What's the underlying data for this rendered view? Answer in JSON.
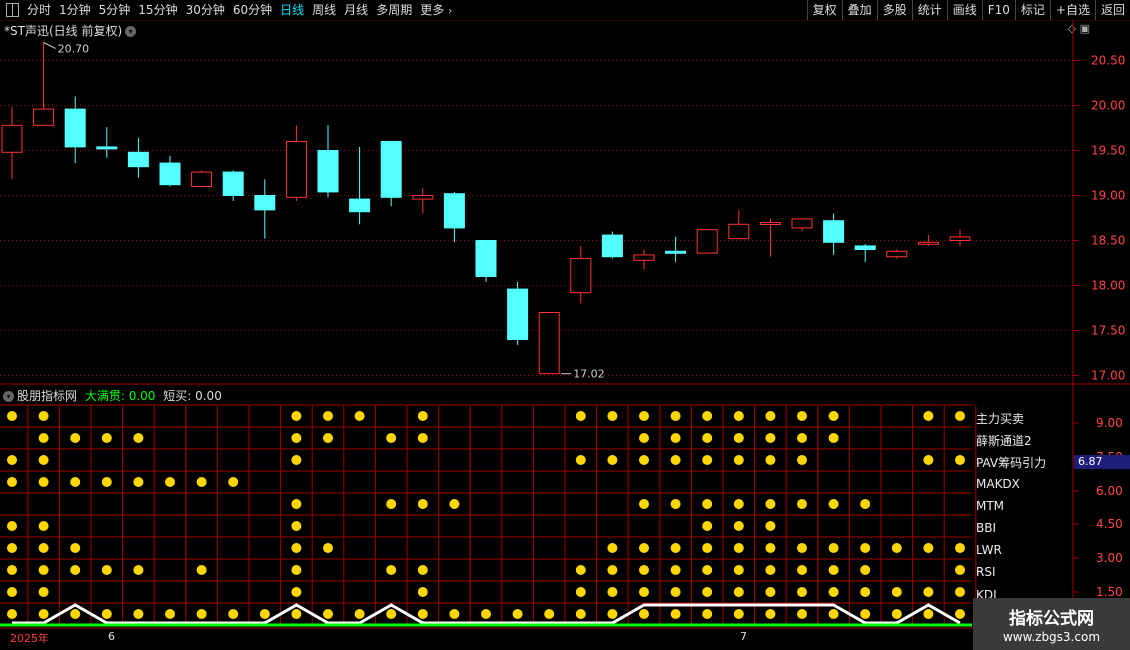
{
  "toolbar": {
    "periods": [
      "分时",
      "1分钟",
      "5分钟",
      "15分钟",
      "30分钟",
      "60分钟",
      "日线",
      "周线",
      "月线",
      "多周期"
    ],
    "active_period": "日线",
    "more_label": "更多",
    "right_buttons": [
      "复权",
      "叠加",
      "多股",
      "统计",
      "画线",
      "F10",
      "标记",
      "+自选",
      "返回"
    ]
  },
  "main_chart": {
    "title": "*ST声迅(日线 前复权)",
    "price_ticks": [
      "20.50",
      "20.00",
      "19.50",
      "19.00",
      "18.50",
      "18.00",
      "17.50",
      "17.00"
    ],
    "high_label": "20.70",
    "low_label": "17.02"
  },
  "indicator": {
    "title": "股朋指标网",
    "series1_label": "大满贯: 0.00",
    "series2_label": "短买: 0.00",
    "value_ticks": [
      "9.00",
      "7.50",
      "6.00",
      "4.50",
      "3.00",
      "1.50"
    ],
    "current_value": "6.87",
    "rows": [
      "主力买卖",
      "薛斯通道2",
      "PAV筹码引力",
      "MAKDX",
      "MTM",
      "BBI",
      "LWR",
      "RSI",
      "KDJ"
    ]
  },
  "date_axis": {
    "labels": [
      "2025年",
      "6",
      "7"
    ]
  },
  "watermark": {
    "line1": "指标公式网",
    "line2": "www.zbgs3.com"
  },
  "colors": {
    "up": "#ff3333",
    "down": "#54ffff",
    "grid": "#a00000",
    "dot": "#ffd700",
    "active": "#00e5ff",
    "green_line": "#00ff00"
  },
  "chart_data": {
    "type": "candlestick",
    "series": [
      {
        "open": 19.48,
        "close": 19.78,
        "high": 19.98,
        "low": 19.18
      },
      {
        "open": 19.78,
        "close": 19.96,
        "high": 20.7,
        "low": 19.78
      },
      {
        "open": 19.96,
        "close": 19.54,
        "high": 20.1,
        "low": 19.36
      },
      {
        "open": 19.54,
        "close": 19.52,
        "high": 19.76,
        "low": 19.42
      },
      {
        "open": 19.48,
        "close": 19.32,
        "high": 19.64,
        "low": 19.2
      },
      {
        "open": 19.36,
        "close": 19.12,
        "high": 19.44,
        "low": 19.1
      },
      {
        "open": 19.1,
        "close": 19.26,
        "high": 19.28,
        "low": 19.1
      },
      {
        "open": 19.26,
        "close": 19.0,
        "high": 19.28,
        "low": 18.94
      },
      {
        "open": 19.0,
        "close": 18.84,
        "high": 19.18,
        "low": 18.52
      },
      {
        "open": 18.98,
        "close": 19.6,
        "high": 19.78,
        "low": 18.94
      },
      {
        "open": 19.5,
        "close": 19.04,
        "high": 19.78,
        "low": 18.98
      },
      {
        "open": 18.96,
        "close": 18.82,
        "high": 19.54,
        "low": 18.68
      },
      {
        "open": 19.6,
        "close": 18.98,
        "high": 19.6,
        "low": 18.88
      },
      {
        "open": 18.96,
        "close": 19.0,
        "high": 19.08,
        "low": 18.8
      },
      {
        "open": 19.02,
        "close": 18.64,
        "high": 19.04,
        "low": 18.48
      },
      {
        "open": 18.5,
        "close": 18.1,
        "high": 18.5,
        "low": 18.04
      },
      {
        "open": 17.96,
        "close": 17.4,
        "high": 18.04,
        "low": 17.34
      },
      {
        "open": 17.02,
        "close": 17.7,
        "high": 17.7,
        "low": 17.02
      },
      {
        "open": 17.92,
        "close": 18.3,
        "high": 18.44,
        "low": 17.8
      },
      {
        "open": 18.56,
        "close": 18.32,
        "high": 18.6,
        "low": 18.3
      },
      {
        "open": 18.28,
        "close": 18.34,
        "high": 18.4,
        "low": 18.18
      },
      {
        "open": 18.38,
        "close": 18.36,
        "high": 18.54,
        "low": 18.26
      },
      {
        "open": 18.36,
        "close": 18.62,
        "high": 18.62,
        "low": 18.36
      },
      {
        "open": 18.52,
        "close": 18.68,
        "high": 18.84,
        "low": 18.52
      },
      {
        "open": 18.68,
        "close": 18.7,
        "high": 18.74,
        "low": 18.32
      },
      {
        "open": 18.64,
        "close": 18.74,
        "high": 18.74,
        "low": 18.6
      },
      {
        "open": 18.72,
        "close": 18.48,
        "high": 18.8,
        "low": 18.34
      },
      {
        "open": 18.44,
        "close": 18.4,
        "high": 18.46,
        "low": 18.26
      },
      {
        "open": 18.32,
        "close": 18.38,
        "high": 18.4,
        "low": 18.3
      },
      {
        "open": 18.46,
        "close": 18.48,
        "high": 18.56,
        "low": 18.44
      },
      {
        "open": 18.5,
        "close": 18.54,
        "high": 18.62,
        "low": 18.44
      }
    ],
    "ylim": [
      16.95,
      20.75
    ],
    "dots": [
      [
        1,
        1,
        0,
        0,
        0,
        0,
        0,
        0,
        0,
        1,
        1,
        1,
        0,
        1,
        0,
        0,
        0,
        0,
        1,
        1,
        1,
        1,
        1,
        1,
        1,
        1,
        1,
        0,
        0,
        1,
        1
      ],
      [
        0,
        1,
        1,
        1,
        1,
        0,
        0,
        0,
        0,
        1,
        1,
        0,
        1,
        1,
        0,
        0,
        0,
        0,
        0,
        0,
        1,
        1,
        1,
        1,
        1,
        1,
        1,
        0,
        0,
        0,
        0
      ],
      [
        1,
        1,
        0,
        0,
        0,
        0,
        0,
        0,
        0,
        1,
        0,
        0,
        0,
        0,
        0,
        0,
        0,
        0,
        1,
        1,
        1,
        1,
        1,
        1,
        1,
        1,
        0,
        0,
        0,
        1,
        1
      ],
      [
        1,
        1,
        1,
        1,
        1,
        1,
        1,
        1,
        0,
        0,
        0,
        0,
        0,
        0,
        0,
        0,
        0,
        0,
        0,
        0,
        0,
        0,
        0,
        0,
        0,
        0,
        0,
        0,
        0,
        0,
        0
      ],
      [
        0,
        0,
        0,
        0,
        0,
        0,
        0,
        0,
        0,
        1,
        0,
        0,
        1,
        1,
        1,
        0,
        0,
        0,
        0,
        0,
        1,
        1,
        1,
        1,
        1,
        1,
        1,
        1,
        0,
        0,
        0
      ],
      [
        1,
        1,
        0,
        0,
        0,
        0,
        0,
        0,
        0,
        1,
        0,
        0,
        0,
        0,
        0,
        0,
        0,
        0,
        0,
        0,
        0,
        0,
        1,
        1,
        1,
        0,
        0,
        0,
        0,
        0,
        0
      ],
      [
        1,
        1,
        1,
        0,
        0,
        0,
        0,
        0,
        0,
        1,
        1,
        0,
        0,
        0,
        0,
        0,
        0,
        0,
        0,
        1,
        1,
        1,
        1,
        1,
        1,
        1,
        1,
        1,
        1,
        1,
        1
      ],
      [
        1,
        1,
        1,
        1,
        1,
        0,
        1,
        0,
        0,
        1,
        0,
        0,
        1,
        1,
        0,
        0,
        0,
        0,
        1,
        1,
        1,
        1,
        1,
        1,
        1,
        1,
        1,
        1,
        0,
        0,
        1
      ],
      [
        1,
        1,
        0,
        0,
        0,
        0,
        0,
        0,
        0,
        1,
        0,
        0,
        0,
        1,
        0,
        0,
        0,
        0,
        1,
        1,
        1,
        1,
        1,
        1,
        1,
        1,
        1,
        1,
        1,
        1,
        1
      ],
      [
        1,
        1,
        1,
        1,
        1,
        1,
        1,
        1,
        1,
        1,
        1,
        1,
        1,
        1,
        1,
        1,
        1,
        1,
        1,
        1,
        1,
        1,
        1,
        1,
        1,
        1,
        1,
        1,
        1,
        1,
        1
      ]
    ],
    "wave": [
      0,
      0,
      1,
      0,
      0,
      0,
      0,
      0,
      0,
      1,
      0,
      0,
      1,
      0,
      0,
      0,
      0,
      0,
      0,
      0,
      1,
      1,
      1,
      1,
      1,
      1,
      1,
      0,
      0,
      1,
      0
    ]
  }
}
